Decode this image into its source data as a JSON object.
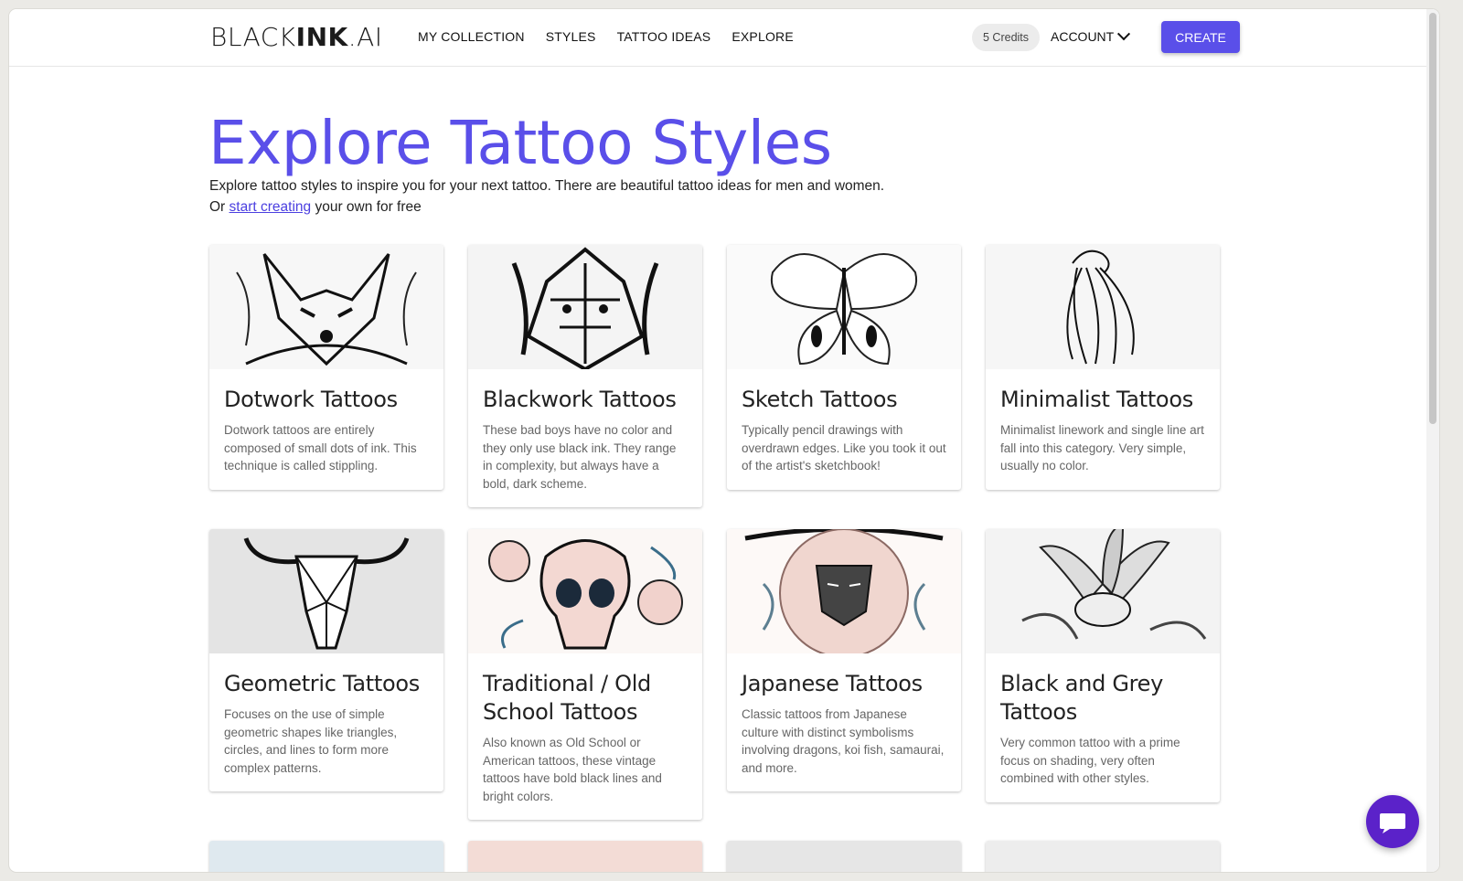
{
  "header": {
    "logo_light": "BLACK",
    "logo_bold": "INK",
    "logo_suffix": ".AI",
    "nav": [
      "MY COLLECTION",
      "STYLES",
      "TATTOO IDEAS",
      "EXPLORE"
    ],
    "credits": "5 Credits",
    "account": "ACCOUNT",
    "create": "CREATE"
  },
  "hero": {
    "title": "Explore Tattoo Styles",
    "desc_line1": "Explore tattoo styles to inspire you for your next tattoo. There are beautiful tattoo ideas for men and women.",
    "desc_prefix": "Or ",
    "desc_link": "start creating",
    "desc_suffix": " your own for free"
  },
  "cards": [
    {
      "title": "Dotwork Tattoos",
      "desc": "Dotwork tattoos are entirely composed of small dots of ink. This technique is called stippling.",
      "icon": "fox-sketch"
    },
    {
      "title": "Blackwork Tattoos",
      "desc": "These bad boys have no color and they only use black ink. They range in complexity, but always have a bold, dark scheme.",
      "icon": "lion-sketch"
    },
    {
      "title": "Sketch Tattoos",
      "desc": "Typically pencil drawings with overdrawn edges. Like you took it out of the artist's sketchbook!",
      "icon": "butterfly-sketch"
    },
    {
      "title": "Minimalist Tattoos",
      "desc": "Minimalist linework and single line art fall into this category. Very simple, usually no color.",
      "icon": "jellyfish-sketch"
    },
    {
      "title": "Geometric Tattoos",
      "desc": "Focuses on the use of simple geometric shapes like triangles, circles, and lines to form more complex patterns.",
      "icon": "bull-skull-sketch"
    },
    {
      "title": "Traditional / Old School Tattoos",
      "desc": "Also known as Old School or American tattoos, these vintage tattoos have bold black lines and bright colors.",
      "icon": "skull-roses"
    },
    {
      "title": "Japanese Tattoos",
      "desc": "Classic tattoos from Japanese culture with distinct symbolisms involving dragons, koi fish, samaurai, and more.",
      "icon": "samurai"
    },
    {
      "title": "Black and Grey Tattoos",
      "desc": "Very common tattoo with a prime focus on shading, very often combined with other styles.",
      "icon": "flower-sketch"
    }
  ],
  "colors": {
    "accent": "#5a4fe9",
    "chat": "#5b22c9"
  }
}
